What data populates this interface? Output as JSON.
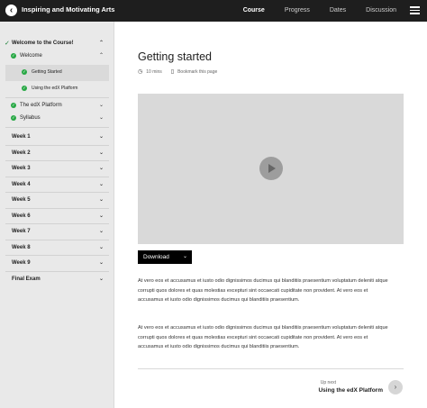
{
  "header": {
    "back_icon": "chevron-left-icon",
    "title": "Inspiring and Motivating Arts",
    "nav": [
      {
        "label": "Course",
        "active": true
      },
      {
        "label": "Progress",
        "active": false
      },
      {
        "label": "Dates",
        "active": false
      },
      {
        "label": "Discussion",
        "active": false
      }
    ],
    "menu_icon": "hamburger-menu-icon"
  },
  "sidebar": {
    "section": {
      "label": "Welcome to the Course!",
      "completed": true
    },
    "items": [
      {
        "label": "Welcome",
        "completed": true
      },
      {
        "label": "Getting Started",
        "completed": true,
        "selected": true
      },
      {
        "label": "Using the edX Platform",
        "completed": true
      },
      {
        "label": "The edX Platform",
        "completed": true
      },
      {
        "label": "Syllabus",
        "completed": true
      }
    ],
    "weeks": [
      "Week 1",
      "Week 2",
      "Week 3",
      "Week 4",
      "Week 5",
      "Week 6",
      "Week 7",
      "Week 8",
      "Week 9",
      "Final Exam"
    ]
  },
  "main": {
    "title": "Getting started",
    "duration": "10 mins",
    "bookmark_label": "Bookmark this page",
    "download_label": "Download",
    "paragraphs": [
      "At vero eos et accusamus et iusto odio dignissimos ducimus qui blanditiis praesentium voluptatum deleniti atque corrupti quos dolores et quas molestias excepturi sint occaecati cupiditate non provident. At vero eos et accusamus et iusto odio dignissimos ducimus qui blanditiis praesentium.",
      "At vero eos et accusamus et iusto odio dignissimos ducimus qui blanditiis praesentium voluptatum deleniti atque corrupti quos dolores et quas molestias excepturi sint occaecati cupiditate non provident. At vero eos et accusamus et iusto odio dignissimos ducimus qui blanditiis praesentium."
    ],
    "up_next_label": "Up next",
    "up_next_title": "Using the edX Platform"
  },
  "colors": {
    "topbar": "#1e1e1e",
    "sidebar": "#e9e9e9",
    "check_green": "#27a844",
    "video_placeholder": "#d9d9d9"
  }
}
